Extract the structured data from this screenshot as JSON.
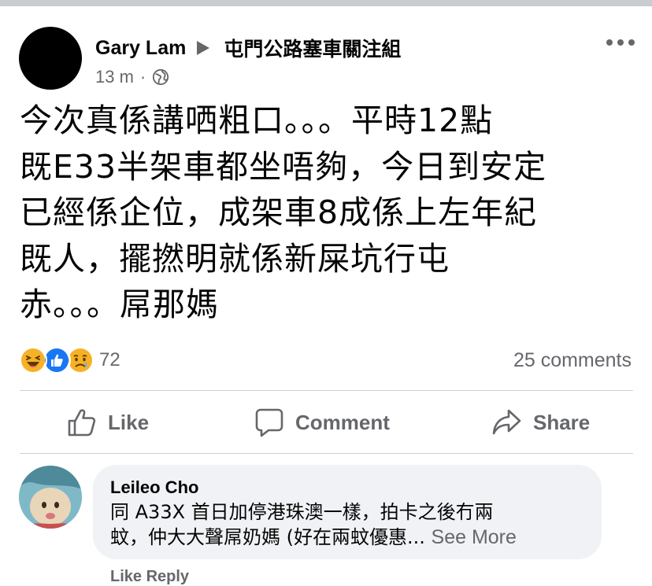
{
  "post": {
    "author": "Gary Lam",
    "group": "屯門公路塞車關注組",
    "time": "13 m",
    "separator": "·",
    "privacy_icon": "globe-icon",
    "text": "今次真係講哂粗口。。。平時12點\n既E33半架車都坐唔夠，今日到安定\n已經係企位，成架車8成係上左年紀\n既人，擺撚明就係新屎坑行屯\n赤。。。屌那媽",
    "reactions": [
      "haha-icon",
      "like-icon",
      "sad-icon"
    ],
    "reaction_count": "72",
    "comments_count": "25 comments"
  },
  "actions": {
    "like": "Like",
    "comment": "Comment",
    "share": "Share"
  },
  "comment": {
    "author": "Leileo Cho",
    "text": "同 A33X 首日加停港珠澳一樣，拍卡之後冇兩\n蚊，仲大大聲屌奶媽 (好在兩蚊優惠... ",
    "see_more": "See More",
    "next_line_partial": "Like    Reply"
  },
  "colors": {
    "secondary_text": "#65676b",
    "like_blue": "#1877f2",
    "bubble_bg": "#f0f2f5",
    "divider": "#ced0d4"
  }
}
